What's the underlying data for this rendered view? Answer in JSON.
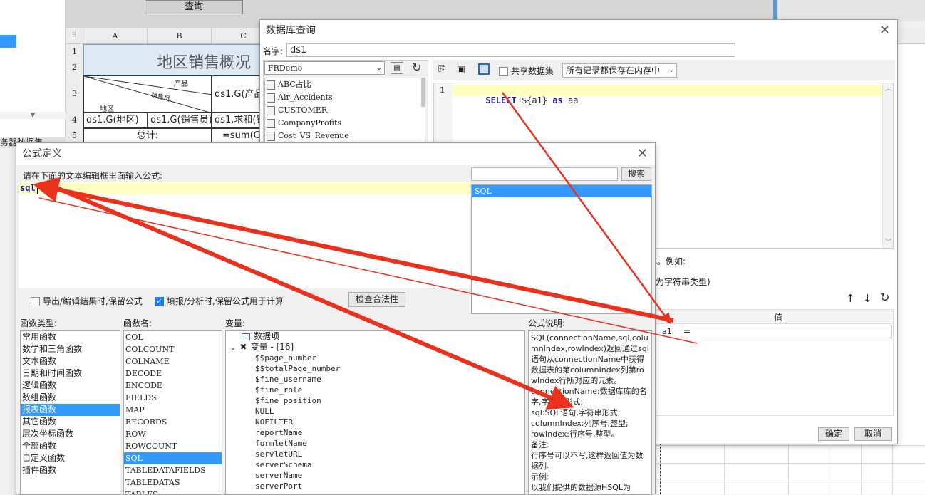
{
  "background": {
    "query_button": "查询",
    "side_panel_label": "务器数据集",
    "sheet": {
      "col_headers": [
        "A",
        "B",
        "C"
      ],
      "row_headers": [
        "1",
        "2",
        "3",
        "4",
        "5"
      ],
      "title": "地区销售概况",
      "diag_product": "产品",
      "diag_salesman": "销售员",
      "diag_region": "地区",
      "c3": "ds1.G(产品)",
      "a4": "ds1.G(地区)",
      "b4": "ds1.G(销售员)",
      "c4": "ds1.求和(销量)",
      "ab5": "总计:",
      "c5": "=sum(C4)"
    }
  },
  "db_dialog": {
    "title": "数据库查询",
    "name_label": "名字:",
    "name_value": "ds1",
    "datasource": "FRDemo",
    "tables": [
      "ABC占比",
      "Air_Accidents",
      "CUSTOMER",
      "CompanyProfits",
      "Cost_VS_Revenue"
    ],
    "share_label": "共享数据集",
    "memory_option": "所有记录都保存在内存中",
    "sql_line_no": "1",
    "sql_keyword": "SELECT",
    "sql_param": "${a1}",
    "sql_as": "as",
    "sql_alias": "aa",
    "hint1": "称。例如:",
    "hint2": "为字符串类型)",
    "param_header": "值",
    "param_name": "a1",
    "param_value": "=",
    "ok_button": "确定",
    "cancel_button": "取消"
  },
  "formula_dialog": {
    "title": "公式定义",
    "prompt": "请在下面的文本编辑框里面输入公式:",
    "formula_text": "sql",
    "search_placeholder": "",
    "search_button": "搜索",
    "search_results": [
      "SQL"
    ],
    "opt_export": "导出/编辑结果时,保留公式",
    "opt_fill": "填报/分析时,保留公式用于计算",
    "check_button": "检查合法性",
    "func_type_label": "函数类型:",
    "func_name_label": "函数名:",
    "var_label": "变量:",
    "desc_label": "公式说明:",
    "func_types": [
      "常用函数",
      "数学和三角函数",
      "文本函数",
      "日期和时间函数",
      "逻辑函数",
      "数组函数",
      "报表函数",
      "其它函数",
      "层次坐标函数",
      "全部函数",
      "自定义函数",
      "插件函数"
    ],
    "func_type_selected": 6,
    "func_names": [
      "COL",
      "COLCOUNT",
      "COLNAME",
      "DECODE",
      "ENCODE",
      "FIELDS",
      "MAP",
      "RECORDS",
      "ROW",
      "ROWCOUNT",
      "SQL",
      "TABLEDATAFIELDS",
      "TABLEDATAS",
      "TABLES"
    ],
    "func_name_selected": 10,
    "var_root": "数据项",
    "var_group": "变量 - [16]",
    "variables": [
      "$$page_number",
      "$$totalPage_number",
      "$fine_username",
      "$fine_role",
      "$fine_position",
      "NULL",
      "NOFILTER",
      "reportName",
      "formletName",
      "servletURL",
      "serverSchema",
      "serverName",
      "serverPort"
    ],
    "description": [
      "SQL(connectionName,sql,columnIndex,rowIndex)返回通过sql语句从connectionName中获得数据表的第columnIndex列第rowIndex行所对应的元素。",
      "connectionName:数据库库的名字,字符串形式;",
      "sql:SQL语句,字符串形式;",
      "columnIndex:列序号,整型;",
      "rowIndex:行序号,整型。",
      "备注:",
      "行序号可以不写,这样返回值为数据列。",
      "示例:",
      "以我们提供的数据源HSQL为"
    ]
  },
  "colors": {
    "accent": "#3399ff",
    "arrow": "#e8321e",
    "highlight_line": "#ffffc0",
    "sql_keyword": "#1a1aa8"
  }
}
